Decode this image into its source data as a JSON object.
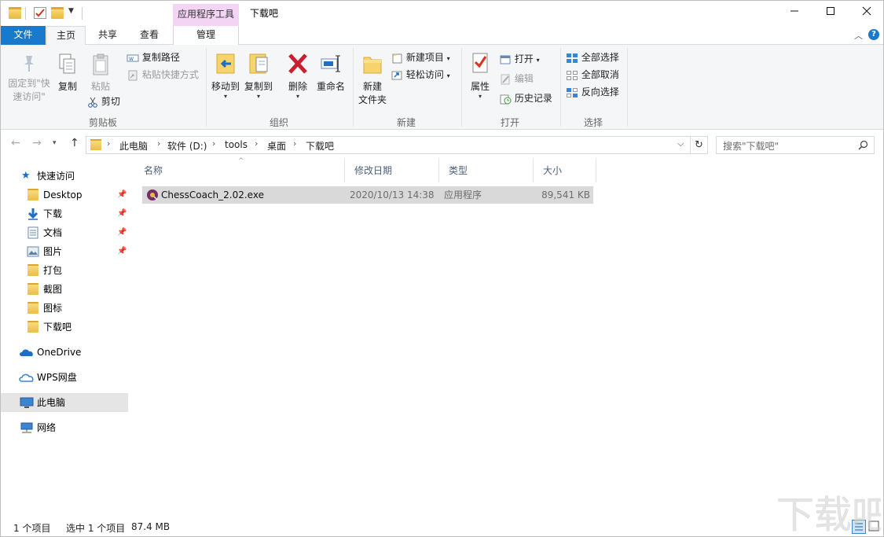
{
  "window": {
    "title": "下载吧",
    "context_tab_title": "应用程序工具",
    "minimize": "—",
    "maximize": "☐",
    "close": "✕"
  },
  "tabs": {
    "file": "文件",
    "home": "主页",
    "share": "共享",
    "view": "查看",
    "manage": "管理"
  },
  "ribbon": {
    "clipboard": {
      "pin_quick_access": "固定到\"快速访问\"",
      "copy": "复制",
      "paste": "粘贴",
      "copy_path": "复制路径",
      "paste_shortcut": "粘贴快捷方式",
      "cut": "剪切",
      "group_label": "剪贴板"
    },
    "organize": {
      "move_to": "移动到",
      "copy_to": "复制到",
      "delete": "删除",
      "rename": "重命名",
      "group_label": "组织"
    },
    "new": {
      "new_folder_line1": "新建",
      "new_folder_line2": "文件夹",
      "new_item": "新建项目",
      "easy_access": "轻松访问",
      "group_label": "新建"
    },
    "open": {
      "properties": "属性",
      "open": "打开",
      "edit": "编辑",
      "history": "历史记录",
      "group_label": "打开"
    },
    "select": {
      "select_all": "全部选择",
      "select_none": "全部取消",
      "invert": "反向选择",
      "group_label": "选择"
    }
  },
  "address": {
    "crumbs": [
      "此电脑",
      "软件 (D:)",
      "tools",
      "桌面",
      "下载吧"
    ],
    "search_placeholder": "搜索\"下载吧\""
  },
  "navpane": {
    "quick_access": "快速访问",
    "items": [
      "Desktop",
      "下载",
      "文档",
      "图片",
      "打包",
      "截图",
      "图标",
      "下载吧"
    ],
    "onedrive": "OneDrive",
    "wps": "WPS网盘",
    "this_pc": "此电脑",
    "network": "网络"
  },
  "filelist": {
    "columns": [
      "名称",
      "修改日期",
      "类型",
      "大小"
    ],
    "rows": [
      {
        "name": "ChessCoach_2.02.exe",
        "date": "2020/10/13 14:38",
        "type": "应用程序",
        "size": "89,541 KB"
      }
    ]
  },
  "status": {
    "count": "1 个项目",
    "selected": "选中 1 个项目",
    "size": "87.4 MB"
  },
  "colors": {
    "accent": "#1979ca",
    "context_tab": "#f3d4f5",
    "selection": "#d9d9d9"
  }
}
